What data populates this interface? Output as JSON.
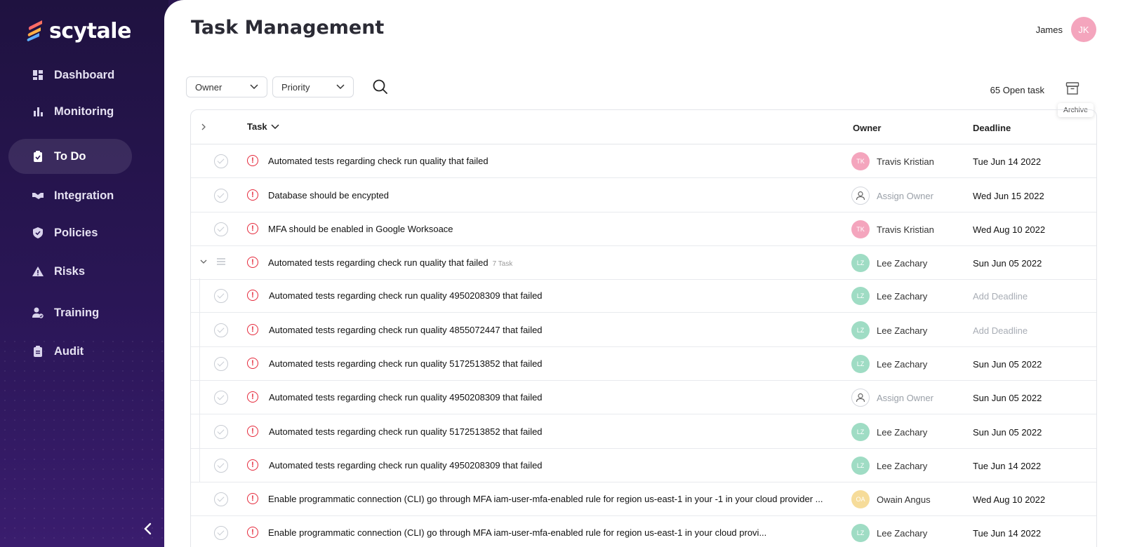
{
  "brand": {
    "name": "scytale"
  },
  "sidebar": {
    "items": [
      {
        "label": "Dashboard",
        "icon": "dashboard-icon"
      },
      {
        "label": "Monitoring",
        "icon": "bar-chart-icon"
      },
      {
        "label": "To Do",
        "icon": "clipboard-check-icon",
        "active": true
      },
      {
        "label": "Integration",
        "icon": "handshake-icon"
      },
      {
        "label": "Policies",
        "icon": "shield-check-icon"
      },
      {
        "label": "Risks",
        "icon": "warning-icon"
      },
      {
        "label": "Training",
        "icon": "user-check-icon"
      },
      {
        "label": "Audit",
        "icon": "clipboard-list-icon"
      }
    ],
    "collapse_icon": "chevron-left-icon"
  },
  "header": {
    "title": "Task Management",
    "user_name": "James",
    "user_initials": "JK"
  },
  "filters": {
    "owner": "Owner",
    "priority": "Priority"
  },
  "summary": {
    "open_count": "65 Open task",
    "archive_tooltip": "Archive"
  },
  "table": {
    "columns": {
      "task": "Task",
      "owner": "Owner",
      "deadline": "Deadline"
    },
    "rows": [
      {
        "task": "Automated tests regarding check run quality that failed",
        "owner": "Travis Kristian",
        "initials": "TK",
        "deadline": "Tue Jun 14 2022"
      },
      {
        "task": "Database should be encypted",
        "owner": "Assign Owner",
        "initials": "",
        "deadline": "Wed Jun 15 2022"
      },
      {
        "task": "MFA should be enabled in Google Worksoace",
        "owner": "Travis Kristian",
        "initials": "TK",
        "deadline": "Wed Aug 10 2022"
      },
      {
        "task": "Automated tests regarding check run quality that failed",
        "subtasks": "7 Task",
        "owner": "Lee Zachary",
        "initials": "LZ",
        "deadline": "Sun Jun 05 2022"
      },
      {
        "task": "Automated tests regarding check run quality 4950208309 that failed",
        "owner": "Lee Zachary",
        "initials": "LZ",
        "deadline": "Add Deadline"
      },
      {
        "task": "Automated tests regarding check run quality 4855072447 that failed",
        "owner": "Lee Zachary",
        "initials": "LZ",
        "deadline": "Add Deadline"
      },
      {
        "task": "Automated tests regarding check run quality 5172513852 that failed",
        "owner": "Lee Zachary",
        "initials": "LZ",
        "deadline": "Sun Jun 05 2022"
      },
      {
        "task": "Automated tests regarding check run quality 4950208309 that failed",
        "owner": "Assign Owner",
        "initials": "",
        "deadline": "Sun Jun 05 2022"
      },
      {
        "task": "Automated tests regarding check run quality 5172513852 that failed",
        "owner": "Lee Zachary",
        "initials": "LZ",
        "deadline": "Sun Jun 05 2022"
      },
      {
        "task": "Automated tests regarding check run quality 4950208309 that failed",
        "owner": "Lee Zachary",
        "initials": "LZ",
        "deadline": "Tue Jun 14 2022"
      },
      {
        "task": "Enable programmatic connection (CLI) go through MFA iam-user-mfa-enabled rule for region us-east-1 in your -1 in your cloud provider ...",
        "owner": "Owain Angus",
        "initials": "OA",
        "deadline": "Wed Aug 10 2022"
      },
      {
        "task": "Enable programmatic connection (CLI) go through MFA iam-user-mfa-enabled rule for region us-east-1 in your cloud provi...",
        "owner": "Lee Zachary",
        "initials": "LZ",
        "deadline": "Tue Jun 14 2022"
      }
    ]
  },
  "colors": {
    "tk": "#f4a5bd",
    "lz": "#9fdcc4",
    "oa": "#f6dc9a",
    "alert": "#e5283a"
  }
}
